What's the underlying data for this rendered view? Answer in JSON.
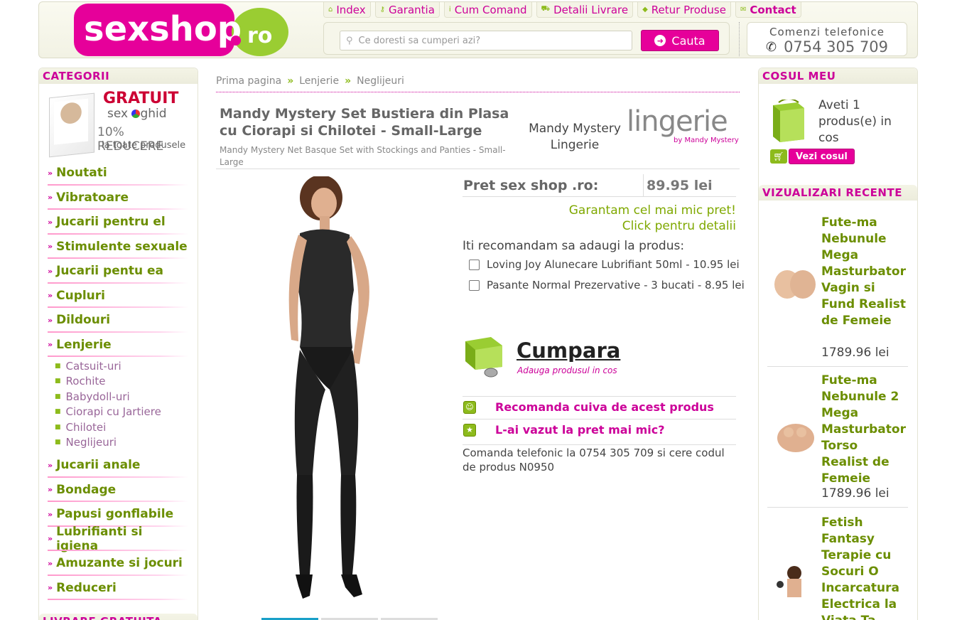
{
  "header": {
    "logo_text": "sexshop",
    "logo_suffix": "ro",
    "nav": [
      {
        "label": "Index",
        "icon": "house-icon"
      },
      {
        "label": "Garantia",
        "icon": "key-icon"
      },
      {
        "label": "Cum Comand",
        "icon": "info-icon"
      },
      {
        "label": "Detalii Livrare",
        "icon": "truck-icon"
      },
      {
        "label": "Retur Produse",
        "icon": "diamond-icon"
      },
      {
        "label": "Contact",
        "icon": "envelope-icon"
      }
    ],
    "search": {
      "placeholder": "Ce doresti sa cumperi azi?",
      "button": "Cauta"
    },
    "phone": {
      "label": "Comenzi telefonice",
      "number": "0754 305 709"
    }
  },
  "categories": {
    "title": "CATEGORII",
    "promo": {
      "line1": "GRATUIT",
      "line2a": "sex",
      "line2b": "ghid",
      "line3": "10% REDUCERE",
      "line4": "la toate produsele"
    },
    "items_top": [
      "Noutati",
      "Vibratoare",
      "Jucarii pentru el",
      "Stimulente sexuale",
      "Jucarii pentu ea",
      "Cupluri",
      "Dildouri",
      "Lenjerie"
    ],
    "subitems": [
      "Catsuit-uri",
      "Rochite",
      "Babydoll-uri",
      "Ciorapi cu Jartiere",
      "Chilotei",
      "Neglijeuri"
    ],
    "items_bottom": [
      "Jucarii anale",
      "Bondage",
      "Papusi gonflabile",
      "Lubrifianti si igiena",
      "Amuzante si jocuri",
      "Reduceri"
    ],
    "next_box_title": "LIVRARE GRATUITA"
  },
  "breadcrumb": [
    "Prima pagina",
    "Lenjerie",
    "Neglijeuri"
  ],
  "product": {
    "title": "Mandy Mystery Set Bustiera din Plasa cu Ciorapi si Chilotei - Small-Large",
    "subtitle": "Mandy Mystery Net Basque Set with Stockings and Panties - Small-Large",
    "brand": "Mandy Mystery Lingerie",
    "brand_logo": "lingerie",
    "brand_logo_by": "by Mandy Mystery",
    "price_label": "Pret sex shop .ro:",
    "price": "89.95 lei",
    "guarantee_line1": "Garantam cel mai mic pret!",
    "guarantee_line2": "Click pentru detalii",
    "recommend_title": "Iti recomandam sa adaugi la produs:",
    "addons": [
      "Loving Joy Alunecare Lubrifiant 50ml - 10.95 lei",
      "Pasante Normal Prezervative - 3 bucati - 8.95 lei"
    ],
    "buy_label": "Cumpara",
    "buy_sub": "Adauga produsul in cos",
    "recommend_friend": "Recomanda cuiva de acest produs",
    "seen_cheaper": "L-ai vazut la pret mai mic?",
    "phone_note": "Comanda telefonic la 0754 305 709 si cere codul de produs N0950"
  },
  "cart": {
    "title": "COSUL MEU",
    "text": "Aveti 1 produs(e) in cos",
    "button": "Vezi cosul"
  },
  "recent": {
    "title": "VIZUALIZARI RECENTE",
    "items": [
      {
        "name": "Fute-ma Nebunule Mega Masturbator Vagin si Fund Realist de Femeie",
        "price": "1789.96 lei"
      },
      {
        "name": "Fute-ma Nebunule 2 Mega Masturbator Torso Realist de Femeie",
        "price": "1789.96 lei"
      },
      {
        "name": "Fetish Fantasy Terapie cu Socuri O Incarcatura Electrica la Viata Ta",
        "price": ""
      }
    ]
  },
  "colors": {
    "brand_pink": "#e6009a",
    "brand_green": "#8dbb1c",
    "category_green": "#6b8e00"
  }
}
